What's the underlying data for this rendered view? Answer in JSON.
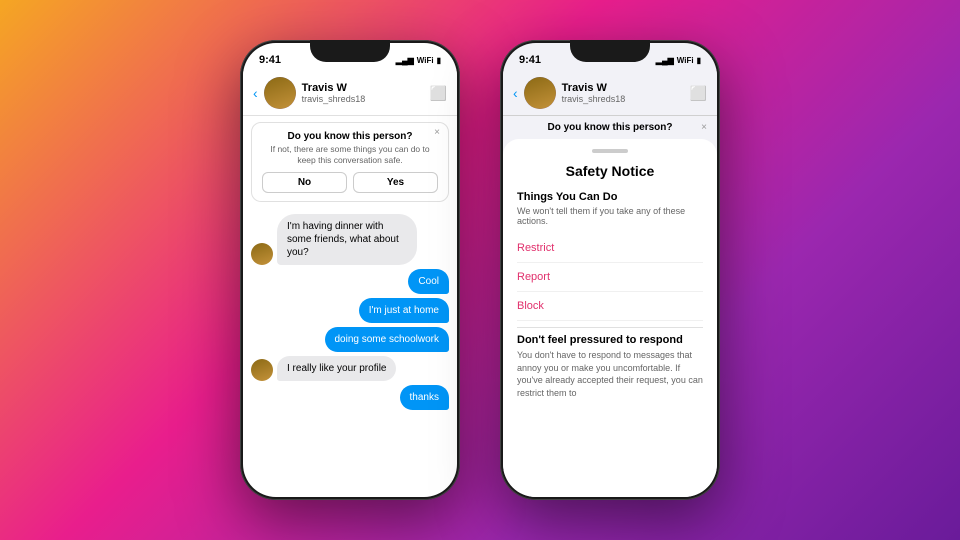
{
  "phone1": {
    "status": {
      "time": "9:41",
      "signal": "●●●",
      "wifi": "wifi",
      "battery": "battery"
    },
    "header": {
      "back": "‹",
      "name": "Travis W",
      "username": "travis_shreds18",
      "video_icon": "□"
    },
    "banner": {
      "title": "Do you know this person?",
      "text": "If not, there are some things you can do to keep this conversation safe.",
      "close": "×",
      "no_label": "No",
      "yes_label": "Yes"
    },
    "messages": [
      {
        "type": "received",
        "text": "I'm having dinner with some friends, what about you?",
        "show_avatar": true
      },
      {
        "type": "sent",
        "text": "Cool"
      },
      {
        "type": "sent",
        "text": "I'm just at home"
      },
      {
        "type": "sent",
        "text": "doing some schoolwork"
      },
      {
        "type": "received",
        "text": "I really like your profile",
        "show_avatar": true
      },
      {
        "type": "sent",
        "text": "thanks"
      }
    ]
  },
  "phone2": {
    "status": {
      "time": "9:41"
    },
    "header": {
      "back": "‹",
      "name": "Travis W",
      "username": "travis_shreds18",
      "video_icon": "□"
    },
    "know_banner": {
      "title": "Do you know this person?",
      "close": "×"
    },
    "safety_sheet": {
      "title": "Safety Notice",
      "section1_title": "Things You Can Do",
      "section1_text": "We won't tell them if you take any of these actions.",
      "action1": "Restrict",
      "action2": "Report",
      "action3": "Block",
      "section2_title": "Don't feel pressured to respond",
      "section2_text": "You don't have to respond to messages that annoy you or make you uncomfortable. If you've already accepted their request, you can restrict them to"
    }
  }
}
